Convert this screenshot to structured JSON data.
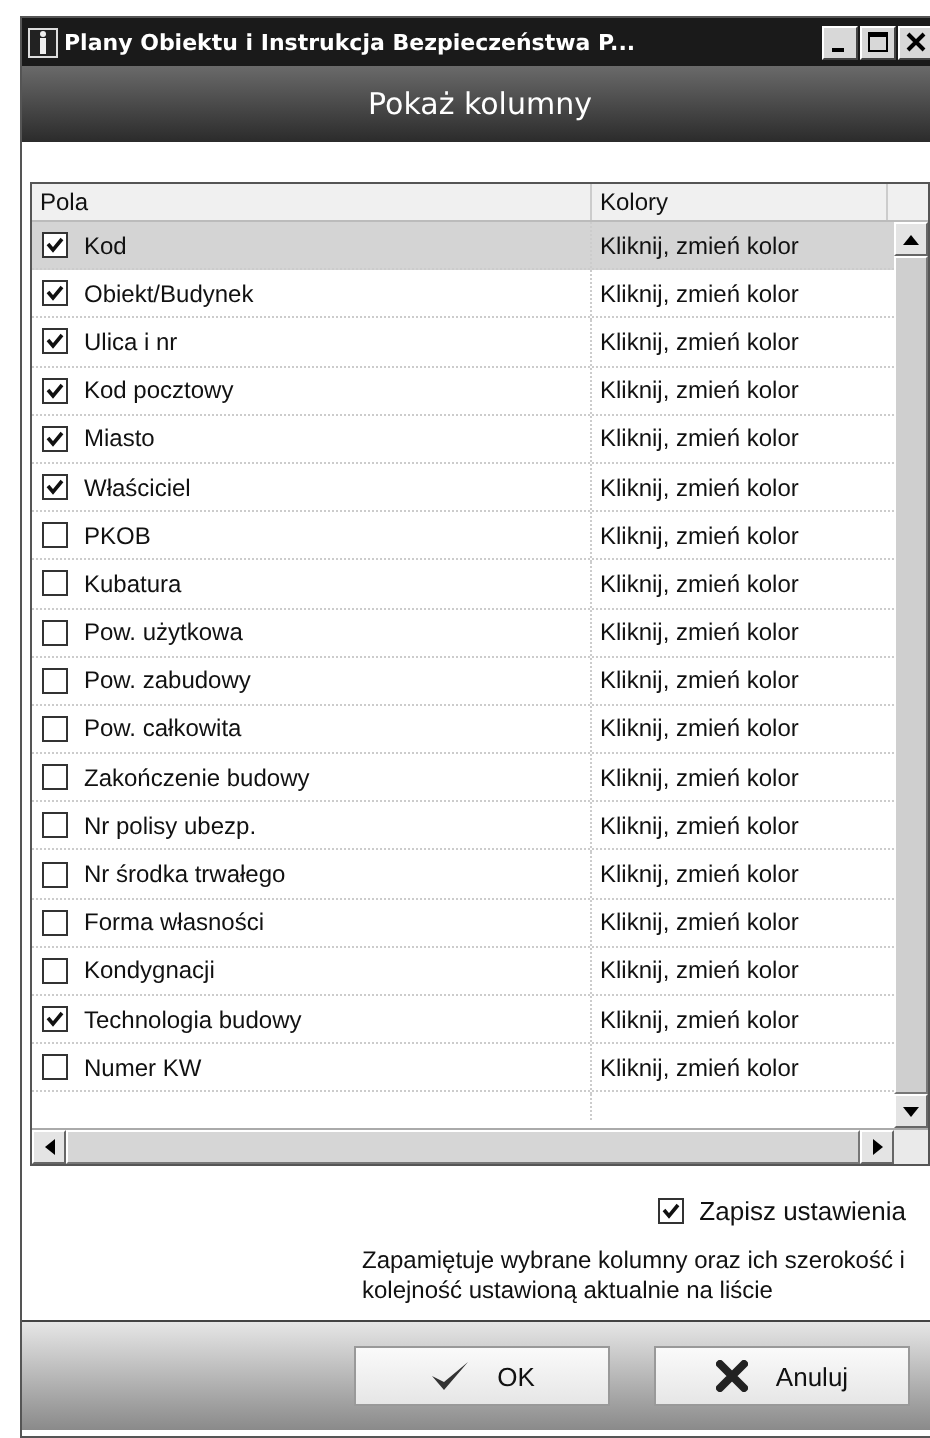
{
  "window": {
    "title": "Plany Obiektu i Instrukcja Bezpieczeństwa P..."
  },
  "header": {
    "title": "Pokaż kolumny"
  },
  "table": {
    "columns": [
      "Pola",
      "Kolory"
    ],
    "rows": [
      {
        "field": "Kod",
        "color_action": "Kliknij, zmień kolor",
        "checked": true,
        "selected": true
      },
      {
        "field": "Obiekt/Budynek",
        "color_action": "Kliknij, zmień kolor",
        "checked": true,
        "selected": false
      },
      {
        "field": "Ulica i nr",
        "color_action": "Kliknij, zmień kolor",
        "checked": true,
        "selected": false
      },
      {
        "field": "Kod pocztowy",
        "color_action": "Kliknij, zmień kolor",
        "checked": true,
        "selected": false
      },
      {
        "field": "Miasto",
        "color_action": "Kliknij, zmień kolor",
        "checked": true,
        "selected": false
      },
      {
        "field": "Właściciel",
        "color_action": "Kliknij, zmień kolor",
        "checked": true,
        "selected": false
      },
      {
        "field": "PKOB",
        "color_action": "Kliknij, zmień kolor",
        "checked": false,
        "selected": false
      },
      {
        "field": "Kubatura",
        "color_action": "Kliknij, zmień kolor",
        "checked": false,
        "selected": false
      },
      {
        "field": "Pow. użytkowa",
        "color_action": "Kliknij, zmień kolor",
        "checked": false,
        "selected": false
      },
      {
        "field": "Pow. zabudowy",
        "color_action": "Kliknij, zmień kolor",
        "checked": false,
        "selected": false
      },
      {
        "field": "Pow. całkowita",
        "color_action": "Kliknij, zmień kolor",
        "checked": false,
        "selected": false
      },
      {
        "field": "Zakończenie budowy",
        "color_action": "Kliknij, zmień kolor",
        "checked": false,
        "selected": false
      },
      {
        "field": "Nr polisy ubezp.",
        "color_action": "Kliknij, zmień kolor",
        "checked": false,
        "selected": false
      },
      {
        "field": "Nr środka trwałego",
        "color_action": "Kliknij, zmień kolor",
        "checked": false,
        "selected": false
      },
      {
        "field": "Forma własności",
        "color_action": "Kliknij, zmień kolor",
        "checked": false,
        "selected": false
      },
      {
        "field": "Kondygnacji",
        "color_action": "Kliknij, zmień kolor",
        "checked": false,
        "selected": false
      },
      {
        "field": "Technologia budowy",
        "color_action": "Kliknij, zmień kolor",
        "checked": true,
        "selected": false
      },
      {
        "field": "Numer KW",
        "color_action": "Kliknij, zmień kolor",
        "checked": false,
        "selected": false
      }
    ]
  },
  "save_settings": {
    "label": "Zapisz ustawienia",
    "checked": true
  },
  "description": "Zapamiętuje wybrane kolumny oraz ich szerokość i kolejność ustawioną aktualnie na liście",
  "buttons": [
    {
      "kind": "ok",
      "label": "OK"
    },
    {
      "kind": "cancel",
      "label": "Anuluj"
    }
  ]
}
